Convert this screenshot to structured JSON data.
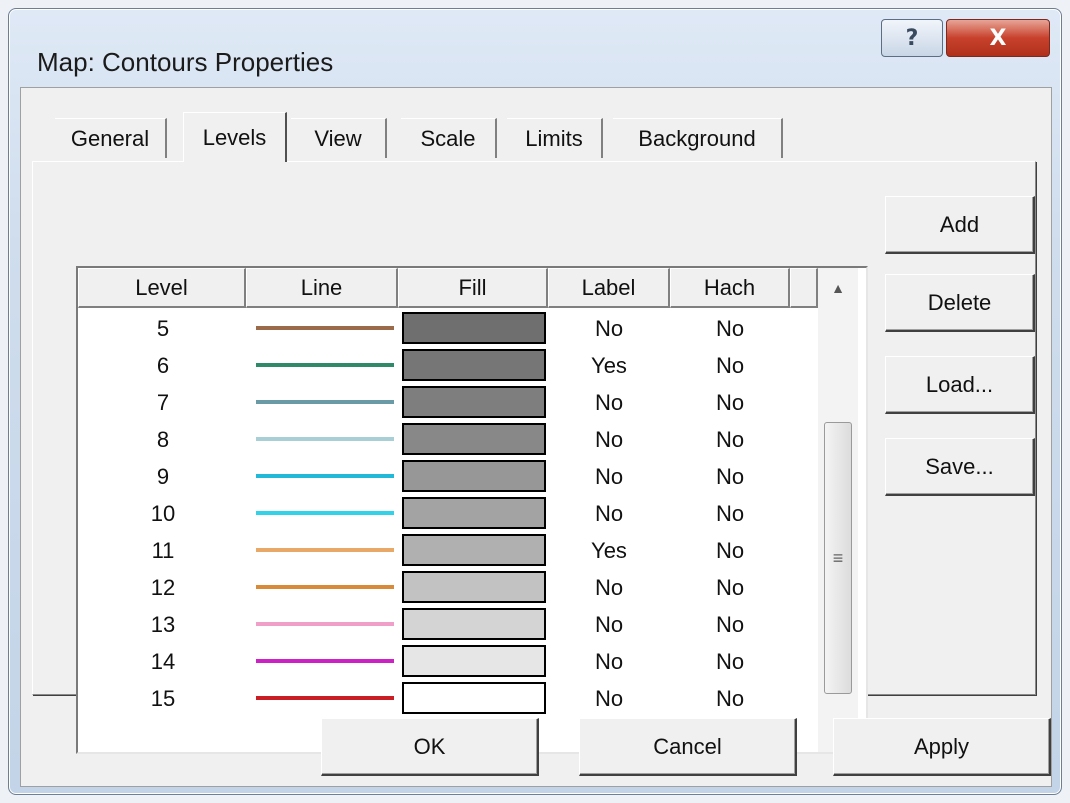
{
  "window": {
    "title": "Map: Contours Properties",
    "help_label": "?",
    "close_label": "X"
  },
  "tabs": [
    {
      "label": "General",
      "active": false
    },
    {
      "label": "Levels",
      "active": true
    },
    {
      "label": "View",
      "active": false
    },
    {
      "label": "Scale",
      "active": false
    },
    {
      "label": "Limits",
      "active": false
    },
    {
      "label": "Background",
      "active": false
    }
  ],
  "table": {
    "columns": [
      "Level",
      "Line",
      "Fill",
      "Label",
      "Hach"
    ],
    "rows": [
      {
        "level": "5",
        "line_color": "#9a6a4a",
        "fill_color": "#6f6f6f",
        "label": "No",
        "hach": "No"
      },
      {
        "level": "6",
        "line_color": "#2f8a6a",
        "fill_color": "#767676",
        "label": "Yes",
        "hach": "No"
      },
      {
        "level": "7",
        "line_color": "#6a9aa6",
        "fill_color": "#7e7e7e",
        "label": "No",
        "hach": "No"
      },
      {
        "level": "8",
        "line_color": "#a8cfd6",
        "fill_color": "#888888",
        "label": "No",
        "hach": "No"
      },
      {
        "level": "9",
        "line_color": "#22b8d8",
        "fill_color": "#979797",
        "label": "No",
        "hach": "No"
      },
      {
        "level": "10",
        "line_color": "#34d2e8",
        "fill_color": "#a3a3a3",
        "label": "No",
        "hach": "No"
      },
      {
        "level": "11",
        "line_color": "#e8a868",
        "fill_color": "#b0b0b0",
        "label": "Yes",
        "hach": "No"
      },
      {
        "level": "12",
        "line_color": "#d88a38",
        "fill_color": "#c2c2c2",
        "label": "No",
        "hach": "No"
      },
      {
        "level": "13",
        "line_color": "#f0a0c8",
        "fill_color": "#d4d4d4",
        "label": "No",
        "hach": "No"
      },
      {
        "level": "14",
        "line_color": "#cc22c4",
        "fill_color": "#e6e6e6",
        "label": "No",
        "hach": "No"
      },
      {
        "level": "15",
        "line_color": "#c81e24",
        "fill_color": "#ffffff",
        "label": "No",
        "hach": "No"
      }
    ]
  },
  "scrollbar": {
    "up_icon": "▲",
    "down_icon": "▼",
    "grip_icon": "≡"
  },
  "side_buttons": [
    "Add",
    "Delete",
    "Load...",
    "Save..."
  ],
  "footer_buttons": [
    "OK",
    "Cancel",
    "Apply"
  ]
}
